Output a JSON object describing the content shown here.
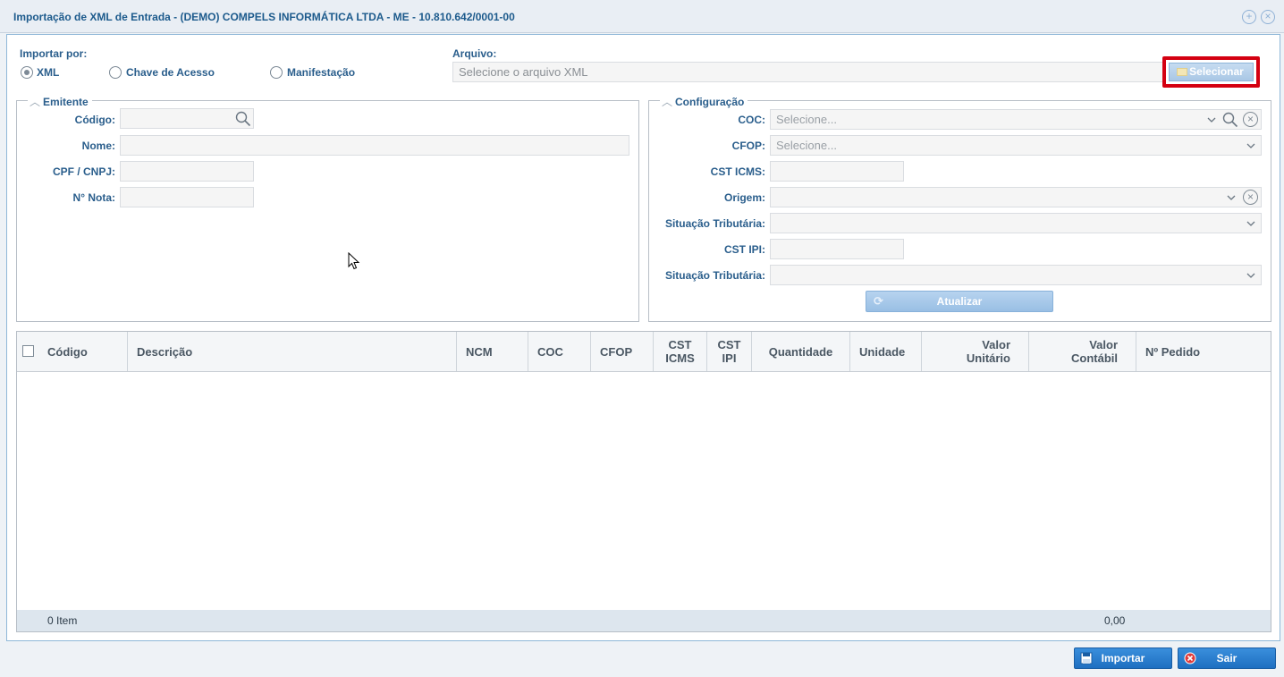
{
  "window": {
    "title": "Importação de XML de Entrada - (DEMO) COMPELS INFORMÁTICA LTDA - ME - 10.810.642/0001-00"
  },
  "import_by": {
    "label": "Importar por:",
    "options": [
      "XML",
      "Chave de Acesso",
      "Manifestação"
    ],
    "selected": "XML"
  },
  "file": {
    "label": "Arquivo:",
    "placeholder": "Selecione o arquivo XML",
    "select_button": "Selecionar"
  },
  "emitente": {
    "legend": "Emitente",
    "codigo_label": "Código:",
    "nome_label": "Nome:",
    "cpf_label": "CPF / CNPJ:",
    "nota_label": "N° Nota:"
  },
  "config": {
    "legend": "Configuração",
    "coc_label": "COC:",
    "coc_placeholder": "Selecione...",
    "cfop_label": "CFOP:",
    "cfop_placeholder": "Selecione...",
    "cst_icms_label": "CST ICMS:",
    "origem_label": "Origem:",
    "sit_trib_label_1": "Situação Tributária:",
    "cst_ipi_label": "CST IPI:",
    "sit_trib_label_2": "Situação Tributária:",
    "update_button": "Atualizar"
  },
  "grid": {
    "columns": {
      "codigo": "Código",
      "descricao": "Descrição",
      "ncm": "NCM",
      "coc": "COC",
      "cfop": "CFOP",
      "cst_icms_1": "CST",
      "cst_icms_2": "ICMS",
      "cst_ipi_1": "CST",
      "cst_ipi_2": "IPI",
      "quantidade": "Quantidade",
      "unidade": "Unidade",
      "valor_unit_1": "Valor",
      "valor_unit_2": "Unitário",
      "valor_cont_1": "Valor",
      "valor_cont_2": "Contábil",
      "pedido": "Nº Pedido"
    },
    "footer_count": "0 Item",
    "footer_total": "0,00"
  },
  "actions": {
    "import": "Importar",
    "exit": "Sair"
  },
  "colors": {
    "accent": "#1e6fc1",
    "highlight": "#d40011",
    "label": "#2a5e8c"
  }
}
